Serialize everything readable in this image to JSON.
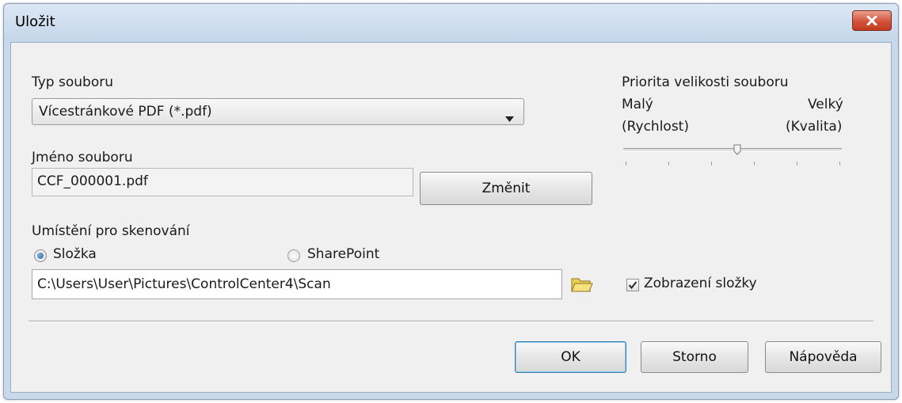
{
  "window": {
    "title": "Uložit"
  },
  "file_type": {
    "label": "Typ souboru",
    "selected": "Vícestránkové PDF (*.pdf)"
  },
  "file_name": {
    "label": "Jméno souboru",
    "value": "CCF_000001.pdf",
    "change_button": "Změnit"
  },
  "scan_location": {
    "label": "Umístění pro skenování",
    "options": [
      {
        "label": "Složka",
        "selected": true
      },
      {
        "label": "SharePoint",
        "selected": false
      }
    ],
    "path": "C:\\Users\\User\\Pictures\\ControlCenter4\\Scan"
  },
  "file_size_priority": {
    "label": "Priorita velikosti souboru",
    "min_label": "Malý",
    "min_sub": "(Rychlost)",
    "max_label": "Velký",
    "max_sub": "(Kvalita)",
    "level_fraction": 0.52,
    "tick_count": 6
  },
  "show_folder": {
    "label": "Zobrazení složky",
    "checked": true
  },
  "buttons": {
    "ok": "OK",
    "cancel": "Storno",
    "help": "Nápověda"
  },
  "icons": {
    "close": "close-icon",
    "dropdown": "chevron-down-icon",
    "browse": "folder-icon",
    "checkmark": "checkmark-icon"
  },
  "colors": {
    "close_button": "#d2533a",
    "window_frame": "#c9d9ec",
    "client_background": "#f0f0f0"
  }
}
